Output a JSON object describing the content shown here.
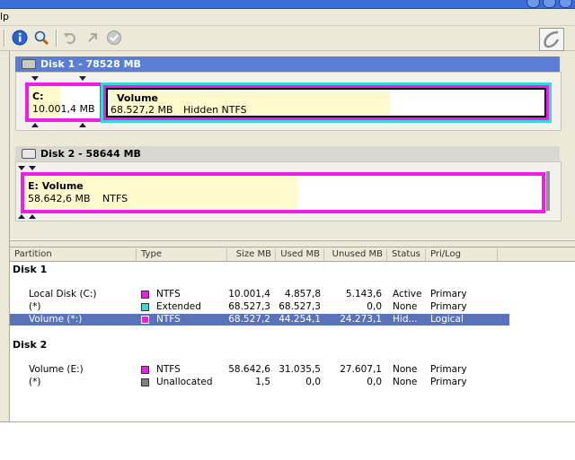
{
  "menu": {
    "partial_label": "lp"
  },
  "toolbar": {
    "icons": [
      "info-icon",
      "zoom-icon",
      "undo-icon",
      "redo-icon",
      "apply-icon",
      "brand-logo-icon"
    ]
  },
  "colors": {
    "partition_border": "#ee1ee8",
    "extended": "#36d8d8",
    "used_fill": "#fffacc",
    "selection": "#5a72b8",
    "disk_header": "#5a7ed6"
  },
  "disk1": {
    "title": "Disk 1 - 78528 MB",
    "partitions": [
      {
        "label": "C:",
        "size": "10.001,4 MB",
        "fs": ""
      },
      {
        "label": "Volume",
        "size": "68.527,2 MB",
        "fs": "Hidden NTFS"
      }
    ]
  },
  "disk2": {
    "title": "Disk 2 - 58644 MB",
    "partitions": [
      {
        "label": "E:  Volume",
        "size": "58.642,6 MB",
        "fs": "NTFS"
      }
    ]
  },
  "list": {
    "columns": [
      "Partition",
      "Type",
      "Size MB",
      "Used MB",
      "Unused MB",
      "Status",
      "Pri/Log"
    ],
    "groups": [
      {
        "name": "Disk 1",
        "rows": [
          {
            "partition": "Local Disk (C:)",
            "type": "NTFS",
            "color": "#ee1ee8",
            "size": "10.001,4",
            "used": "4.857,8",
            "unused": "5.143,6",
            "status": "Active",
            "prilog": "Primary"
          },
          {
            "partition": "(*)",
            "type": "Extended",
            "color": "#36d8d8",
            "size": "68.527,3",
            "used": "68.527,3",
            "unused": "0,0",
            "status": "None",
            "prilog": "Primary"
          },
          {
            "partition": "Volume (*:)",
            "type": "NTFS",
            "color": "#ee1ee8",
            "size": "68.527,2",
            "used": "44.254,1",
            "unused": "24.273,1",
            "status": "Hid...",
            "prilog": "Logical"
          }
        ]
      },
      {
        "name": "Disk 2",
        "rows": [
          {
            "partition": "Volume (E:)",
            "type": "NTFS",
            "color": "#ee1ee8",
            "size": "58.642,6",
            "used": "31.035,5",
            "unused": "27.607,1",
            "status": "None",
            "prilog": "Primary"
          },
          {
            "partition": "(*)",
            "type": "Unallocated",
            "color": "#808080",
            "size": "1,5",
            "used": "0,0",
            "unused": "0,0",
            "status": "None",
            "prilog": "Primary"
          }
        ]
      }
    ]
  }
}
